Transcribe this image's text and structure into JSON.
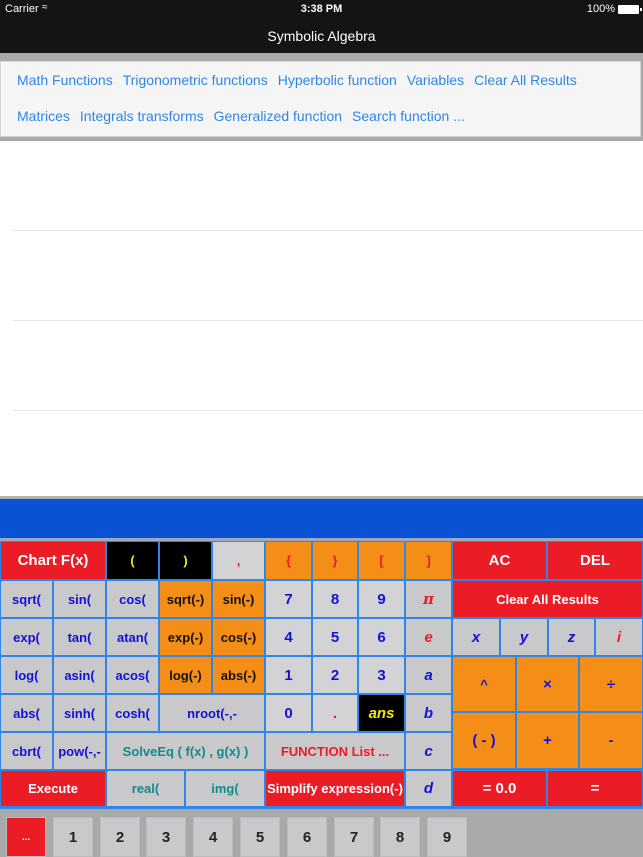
{
  "status_bar": {
    "carrier": "Carrier",
    "wifi_icon": "wifi-icon",
    "time": "3:38 PM",
    "battery_percent": "100%",
    "battery_icon": "battery-icon"
  },
  "nav": {
    "title": "Symbolic Algebra"
  },
  "menu": {
    "row1": [
      "Math Functions",
      "Trigonometric functions",
      "Hyperbolic function",
      "Variables",
      "Clear All Results"
    ],
    "row2": [
      "Matrices",
      "Integrals transforms",
      "Generalized function",
      "Search function ..."
    ]
  },
  "results": {
    "rows": [
      "",
      "",
      "",
      ""
    ]
  },
  "input": {
    "value": ""
  },
  "keypad": {
    "chart": "Chart F(x)",
    "lparen": "(",
    "rparen": ")",
    "comma": ",",
    "lbrace": "{",
    "rbrace": "}",
    "lbracket": "[",
    "rbracket": "]",
    "ac": "AC",
    "del": "DEL",
    "sqrt": "sqrt(",
    "sin": "sin(",
    "cos": "cos(",
    "sqrt_neg": "sqrt(-)",
    "sin_neg": "sin(-)",
    "n7": "7",
    "n8": "8",
    "n9": "9",
    "pi": "π",
    "clear_all": "Clear All Results",
    "exp": "exp(",
    "tan": "tan(",
    "atan": "atan(",
    "exp_neg": "exp(-)",
    "cos_neg": "cos(-)",
    "n4": "4",
    "n5": "5",
    "n6": "6",
    "e": "e",
    "x": "x",
    "y": "y",
    "z": "z",
    "i": "i",
    "log": "log(",
    "asin": "asin(",
    "acos": "acos(",
    "log_neg": "log(-)",
    "abs_neg": "abs(-)",
    "n1": "1",
    "n2": "2",
    "n3": "3",
    "a": "a",
    "pow_op": "^",
    "mul": "×",
    "div": "÷",
    "abs": "abs(",
    "sinh": "sinh(",
    "cosh": "cosh(",
    "nroot": "nroot(-,-",
    "n0": "0",
    "dot": ".",
    "ans": "ans",
    "b": "b",
    "cbrt": "cbrt(",
    "pow": "pow(-,-",
    "solveeq": "SolveEq ( f(x) , g(x) )",
    "function_list": "FUNCTION List ...",
    "c": "c",
    "negate": "( - )",
    "plus": "+",
    "minus": "-",
    "execute": "Execute",
    "real": "real(",
    "img": "img(",
    "simplify": "Simplify expression(-)",
    "d": "d",
    "eval_result": "= 0.0",
    "equals": "="
  },
  "tabs": [
    "...",
    "1",
    "2",
    "3",
    "4",
    "5",
    "6",
    "7",
    "8",
    "9"
  ],
  "active_tab": 0,
  "colors": {
    "red": "#ec1c27",
    "orange": "#f58e16",
    "gray": "#c9c9cb",
    "blue_text": "#1212d6",
    "link_blue": "#2f86e6",
    "input_blue": "#0a52d2"
  }
}
